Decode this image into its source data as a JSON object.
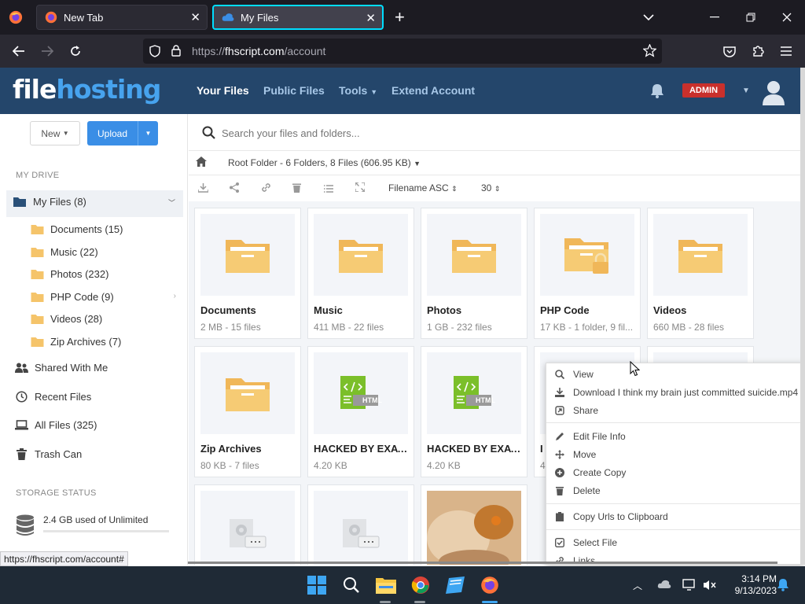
{
  "browser": {
    "tabs": [
      {
        "label": "New Tab"
      },
      {
        "label": "My Files"
      }
    ],
    "url_prefix": "https://",
    "url_host": "fhscript.com",
    "url_path": "/account",
    "status_url": "https://fhscript.com/account#"
  },
  "header": {
    "logo_part1": "file",
    "logo_part2": "hosting",
    "nav": [
      {
        "label": "Your Files"
      },
      {
        "label": "Public Files"
      },
      {
        "label": "Tools"
      },
      {
        "label": "Extend Account"
      }
    ],
    "admin_label": "ADMIN"
  },
  "sidebar": {
    "new_label": "New",
    "upload_label": "Upload",
    "my_drive_heading": "MY DRIVE",
    "my_files": "My Files (8)",
    "folders": [
      {
        "label": "Documents (15)"
      },
      {
        "label": "Music (22)"
      },
      {
        "label": "Photos (232)"
      },
      {
        "label": "PHP Code (9)"
      },
      {
        "label": "Videos (28)"
      },
      {
        "label": "Zip Archives (7)"
      }
    ],
    "shared": "Shared With Me",
    "recent": "Recent Files",
    "all_files": "All Files (325)",
    "trash": "Trash Can",
    "storage_heading": "STORAGE STATUS",
    "storage_text": "2.4 GB used of Unlimited"
  },
  "main": {
    "search_placeholder": "Search your files and folders...",
    "breadcrumb": "Root Folder - 6 Folders, 8 Files (606.95 KB)",
    "sort_label": "Filename ASC",
    "per_page": "30",
    "cards": [
      {
        "name": "Documents",
        "meta": "2 MB - 15 files"
      },
      {
        "name": "Music",
        "meta": "411 MB - 22 files"
      },
      {
        "name": "Photos",
        "meta": "1 GB - 232 files"
      },
      {
        "name": "PHP Code",
        "meta": "17 KB - 1 folder, 9 fil..."
      },
      {
        "name": "Videos",
        "meta": "660 MB - 28 files"
      },
      {
        "name": "Zip Archives",
        "meta": "80 KB - 7 files"
      },
      {
        "name": "HACKED BY EXAY...",
        "meta": "4.20 KB"
      },
      {
        "name": "HACKED BY EXAY...",
        "meta": "4.20 KB"
      },
      {
        "name": "I",
        "meta": "4"
      }
    ],
    "html_tag": "HTML"
  },
  "context_menu": {
    "items": [
      {
        "label": "View"
      },
      {
        "label": "Download I think my brain just committed suicide.mp4"
      },
      {
        "label": "Share"
      },
      {
        "label": "Edit File Info"
      },
      {
        "label": "Move"
      },
      {
        "label": "Create Copy"
      },
      {
        "label": "Delete"
      },
      {
        "label": "Copy Urls to Clipboard"
      },
      {
        "label": "Select File"
      },
      {
        "label": "Links"
      }
    ]
  },
  "taskbar": {
    "time": "3:14 PM",
    "date": "9/13/2023"
  },
  "colors": {
    "header_bg": "#24466b",
    "accent_blue": "#3a8ee6",
    "folder": "#f5c46a",
    "admin_red": "#c9302c",
    "html_green": "#7bbf2a"
  }
}
